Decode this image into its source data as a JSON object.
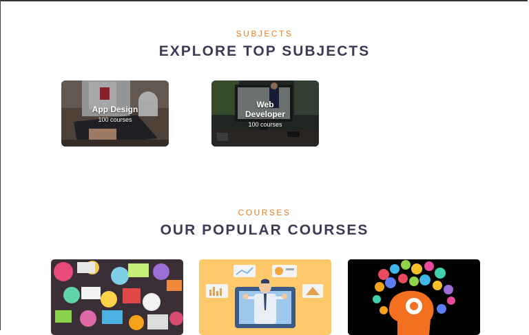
{
  "subjects_section": {
    "eyebrow": "SUBJECTS",
    "title": "EXPLORE TOP SUBJECTS",
    "cards": [
      {
        "title": "App Design",
        "count": "100 courses"
      },
      {
        "title": "Web Developer",
        "count": "100 courses"
      }
    ]
  },
  "courses_section": {
    "eyebrow": "COURSES",
    "title": "OUR POPULAR COURSES",
    "cards": [
      {
        "image": "doodle-art-image"
      },
      {
        "image": "online-teacher-laptop-image"
      },
      {
        "image": "brain-icons-head-image"
      }
    ]
  },
  "colors": {
    "accent": "#e87d1e",
    "heading": "#3c3b55",
    "course2_bg": "#ffc86b",
    "course3_bg": "#000000"
  }
}
